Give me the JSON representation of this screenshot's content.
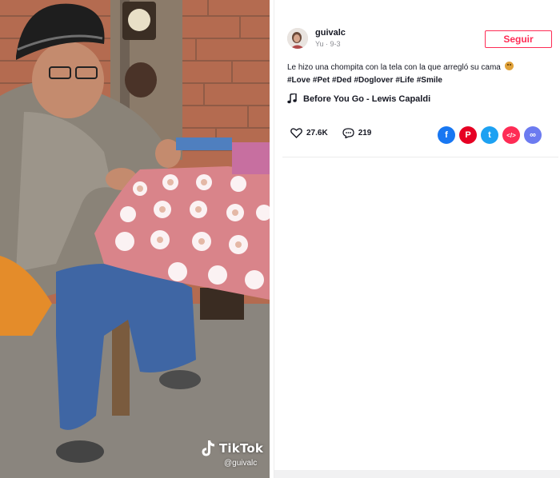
{
  "video": {
    "watermark_brand": "TikTok",
    "watermark_handle": "@guivalc"
  },
  "author": {
    "username": "guivalc",
    "subline": "Yu · 9-3",
    "follow_label": "Seguir"
  },
  "caption": {
    "text": "Le hizo una chompita con la tela con la que arregló su cama",
    "hashtags": [
      "#Love",
      "#Pet",
      "#Ded",
      "#Doglover",
      "#Life",
      "#Smile"
    ]
  },
  "music": {
    "icon": "music-note-icon",
    "title": "Before You Go - Lewis Capaldi"
  },
  "stats": {
    "likes": "27.6K",
    "comments": "219"
  },
  "share": [
    {
      "name": "facebook",
      "color": "#1877f2",
      "glyph": "f"
    },
    {
      "name": "pinterest",
      "color": "#e60023",
      "glyph": "P"
    },
    {
      "name": "twitter",
      "color": "#1da1f2",
      "glyph": "t"
    },
    {
      "name": "embed",
      "color": "#fe2c55",
      "glyph": "</>"
    },
    {
      "name": "link",
      "color": "#6c7bf0",
      "glyph": "∞"
    }
  ],
  "colors": {
    "accent": "#fe2c55",
    "text": "#161823",
    "muted": "#8a8b91"
  }
}
